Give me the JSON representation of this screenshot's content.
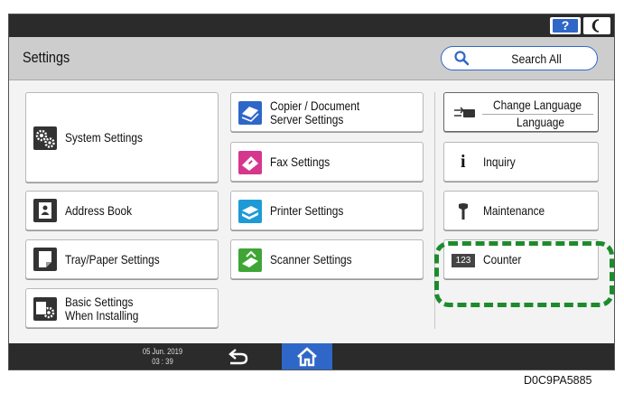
{
  "topbar": {
    "help_label": "?"
  },
  "header": {
    "title": "Settings",
    "search_label": "Search All"
  },
  "left_tiles": [
    {
      "label": "System Settings"
    },
    {
      "label": "Address Book"
    },
    {
      "label": "Tray/Paper Settings"
    },
    {
      "label_line1": "Basic Settings",
      "label_line2": "When Installing"
    }
  ],
  "mid_tiles": [
    {
      "label_line1": "Copier / Document",
      "label_line2": "Server Settings"
    },
    {
      "label": "Fax Settings"
    },
    {
      "label": "Printer Settings"
    },
    {
      "label": "Scanner Settings"
    }
  ],
  "right_tiles": {
    "change_language_top": "Change Language",
    "change_language_bottom": "Language",
    "inquiry": "Inquiry",
    "maintenance": "Maintenance",
    "counter_icon_text": "123",
    "counter": "Counter"
  },
  "status": {
    "date": "05 Jun. 2019",
    "time": "03 : 39"
  },
  "caption": "D0C9PA5885",
  "colors": {
    "accent": "#2f67c8",
    "highlight": "#1d8b2c",
    "bar": "#2b2b2b"
  }
}
